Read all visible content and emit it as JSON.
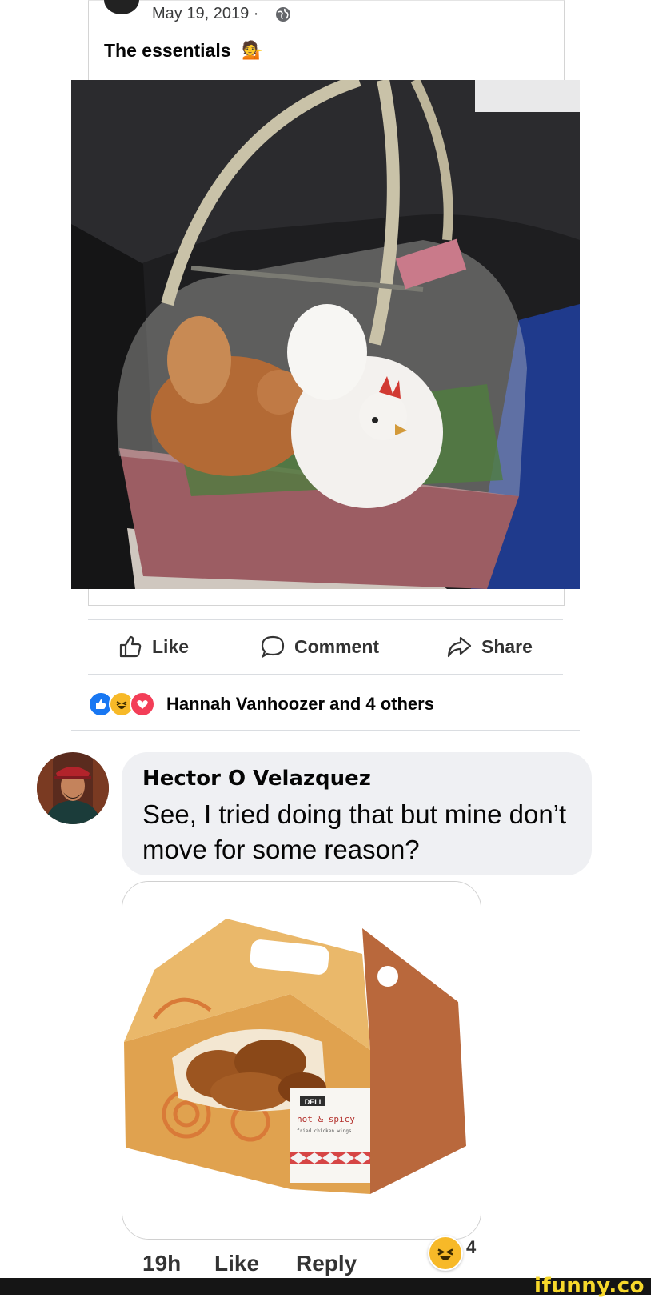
{
  "post": {
    "date": "May 19, 2019 · ",
    "text": "The essentials",
    "emoji": "💁"
  },
  "actions": {
    "like": "Like",
    "comment": "Comment",
    "share": "Share"
  },
  "reactions": {
    "summary": "Hannah Vanhoozer and 4 others",
    "icons": [
      "like-reaction",
      "haha-reaction",
      "love-reaction"
    ]
  },
  "comment": {
    "author": "Hector O Velazquez",
    "text": "See, I tried doing that but mine don’t move for some reason?",
    "attachment_labels": {
      "deli": "DELI",
      "product": "hot & spicy",
      "sub": "fried chicken wings"
    },
    "time": "19h",
    "like": "Like",
    "reply": "Reply",
    "reaction_count": "4"
  },
  "watermark": "ifunny.co",
  "colors": {
    "like_blue": "#1877f2",
    "love_red": "#f33e58",
    "haha_yellow": "#f7b928",
    "bubble_gray": "#eff0f3",
    "banner": "#151515",
    "watermark": "#f7d82b"
  }
}
